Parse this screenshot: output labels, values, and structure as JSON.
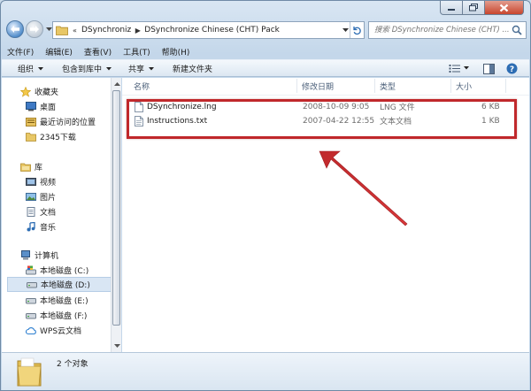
{
  "window": {
    "caption_buttons": [
      "minimize",
      "maximize",
      "close"
    ]
  },
  "address": {
    "crumbs": [
      "DSynchroniz",
      "DSynchronize Chinese (CHT) Pack"
    ]
  },
  "search": {
    "placeholder": "搜索 DSynchronize Chinese (CHT) ..."
  },
  "menubar": {
    "items": [
      "文件(F)",
      "编辑(E)",
      "查看(V)",
      "工具(T)",
      "帮助(H)"
    ]
  },
  "commandbar": {
    "items": [
      {
        "label": "组织",
        "has_dropdown": true
      },
      {
        "label": "包含到库中",
        "has_dropdown": true
      },
      {
        "label": "共享",
        "has_dropdown": true
      },
      {
        "label": "新建文件夹",
        "has_dropdown": false
      }
    ]
  },
  "navpane": {
    "favorites": {
      "label": "收藏夹",
      "items": [
        "桌面",
        "最近访问的位置",
        "2345下载"
      ]
    },
    "libraries": {
      "label": "库",
      "items": [
        "视频",
        "图片",
        "文档",
        "音乐"
      ]
    },
    "computer": {
      "label": "计算机",
      "items": [
        "本地磁盘 (C:)",
        "本地磁盘 (D:)",
        "本地磁盘 (E:)",
        "本地磁盘 (F:)",
        "WPS云文档"
      ],
      "selected": "本地磁盘 (D:)"
    }
  },
  "columns": {
    "name": "名称",
    "modified": "修改日期",
    "type": "类型",
    "size": "大小"
  },
  "files": [
    {
      "name": "DSynchronize.lng",
      "modified": "2008-10-09 9:05",
      "type": "LNG 文件",
      "size": "6 KB"
    },
    {
      "name": "Instructions.txt",
      "modified": "2007-04-22 12:55",
      "type": "文本文档",
      "size": "1 KB"
    }
  ],
  "annotation": {
    "box_color": "#c0282b",
    "arrow_color": "#c0282b"
  },
  "status": {
    "count_text": "2 个对象"
  },
  "colors": {
    "selection": "#d9e6f4",
    "header_text": "#4c607a",
    "window_frame": "#c4d7ea"
  }
}
